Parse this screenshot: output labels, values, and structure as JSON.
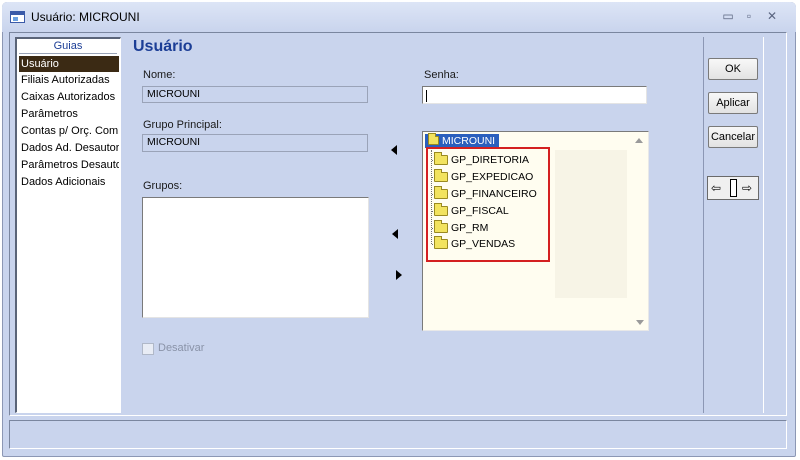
{
  "window": {
    "title": "Usuário: MICROUNI",
    "controls": {
      "minimize": "▭",
      "restore": "▫",
      "close": "✕"
    }
  },
  "sidebar": {
    "header": "Guias",
    "items": [
      {
        "label": "Usuário",
        "selected": true
      },
      {
        "label": "Filiais Autorizadas",
        "selected": false
      },
      {
        "label": "Caixas Autorizados",
        "selected": false
      },
      {
        "label": "Parâmetros",
        "selected": false
      },
      {
        "label": "Contas p/ Orç. Combi",
        "selected": false
      },
      {
        "label": "Dados Ad. Desautoriz",
        "selected": false
      },
      {
        "label": "Parâmetros Desautori",
        "selected": false
      },
      {
        "label": "Dados Adicionais",
        "selected": false
      }
    ]
  },
  "form": {
    "section_title": "Usuário",
    "nome_label": "Nome:",
    "nome_value": "MICROUNI",
    "senha_label": "Senha:",
    "senha_value": "",
    "grupo_principal_label": "Grupo Principal:",
    "grupo_principal_value": "MICROUNI",
    "grupos_label": "Grupos:",
    "desativar_label": "Desativar",
    "desativar_checked": false
  },
  "tree": {
    "root": "MICROUNI",
    "items": [
      "GP_DIRETORIA",
      "GP_EXPEDICAO",
      "GP_FINANCEIRO",
      "GP_FISCAL",
      "GP_RM",
      "GP_VENDAS"
    ]
  },
  "buttons": {
    "ok": "OK",
    "aplicar": "Aplicar",
    "cancelar": "Cancelar"
  },
  "nav_widget": {
    "left": "⇦",
    "right": "⇨"
  },
  "colors": {
    "window_bg": "#c9d4ed",
    "accent_title": "#1c3e96",
    "selection": "#3b2a14",
    "tree_selection": "#2a5fbd",
    "highlight": "#d42020"
  }
}
